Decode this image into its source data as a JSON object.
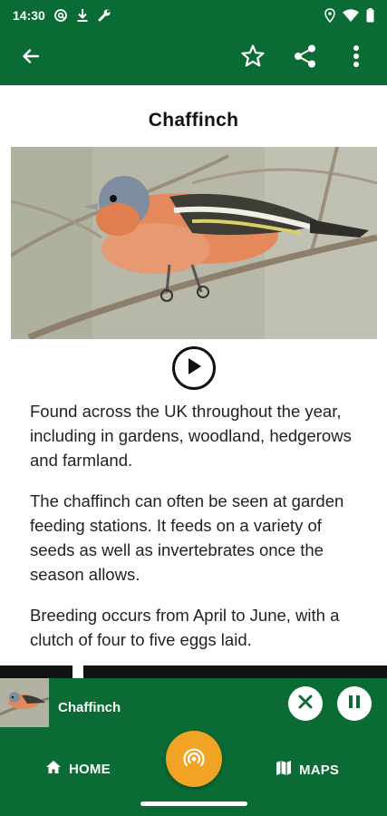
{
  "status_bar": {
    "time": "14:30",
    "left_icons": [
      "at-sign-icon",
      "download-icon",
      "wrench-icon"
    ],
    "right_icons": [
      "location-icon",
      "wifi-icon",
      "battery-icon"
    ]
  },
  "app_bar": {
    "back_icon": "arrow-back-icon",
    "favorite_icon": "star-outline-icon",
    "share_icon": "share-icon",
    "menu_icon": "more-vert-icon"
  },
  "species": {
    "name": "Chaffinch",
    "image_alt_icon": "chaffinch-photo",
    "play_icon": "play-icon",
    "paragraphs": [
      "Found across the UK throughout the year, including in gardens, woodland, hedgerows and farmland.",
      "The chaffinch can often be seen at garden feeding stations. It feeds on a variety of seeds as well as invertebrates once the season allows.",
      "Breeding occurs from April to June, with a clutch of four to five eggs laid."
    ]
  },
  "mini_player": {
    "title": "Chaffinch",
    "close_icon": "close-icon",
    "pause_icon": "pause-icon"
  },
  "bottom_nav": {
    "home_label": "HOME",
    "home_icon": "home-icon",
    "maps_label": "MAPS",
    "maps_icon": "map-icon",
    "fab_icon": "broadcast-icon"
  },
  "colors": {
    "primary_green": "#0a6b34",
    "accent_orange": "#f1a323"
  }
}
